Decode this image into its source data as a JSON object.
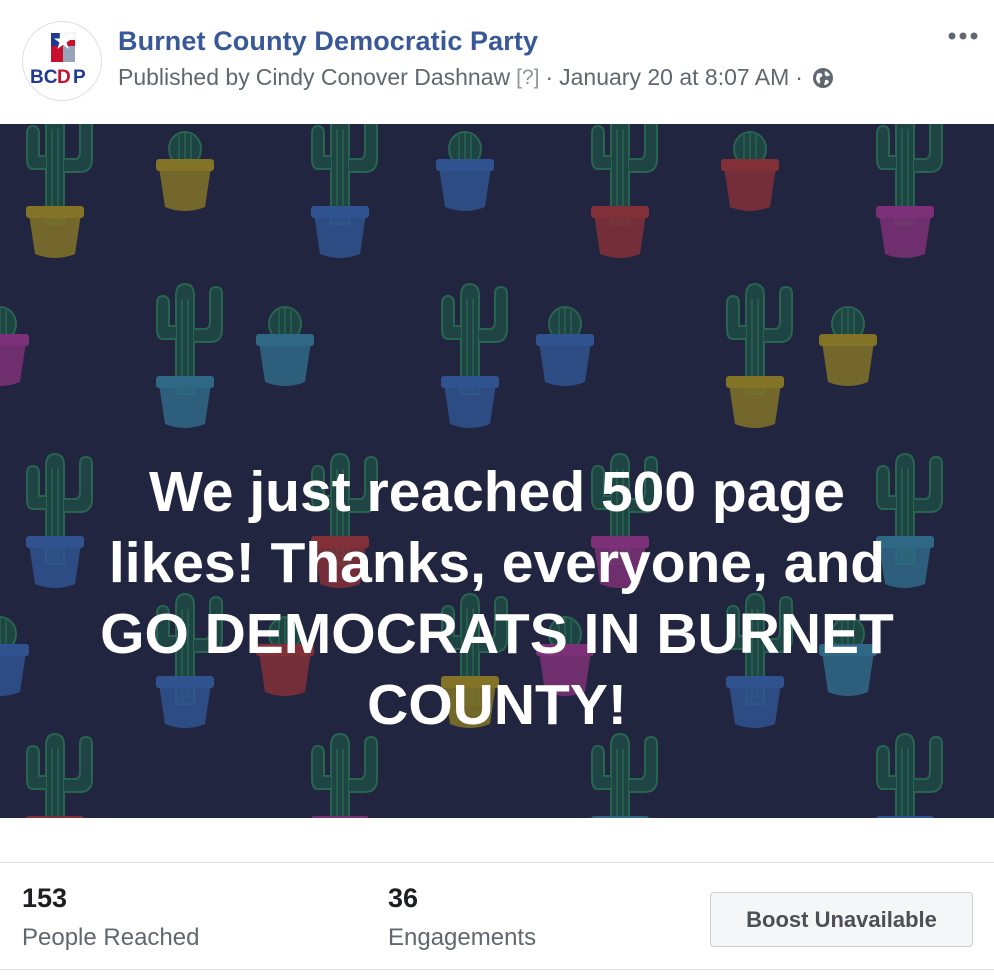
{
  "post": {
    "page_name": "Burnet County Democratic Party",
    "avatar_text": "BCDP",
    "published_prefix": "Published by",
    "author": "Cindy Conover Dashnaw",
    "help_marker": "[?]",
    "separator": "·",
    "timestamp": "January 20 at 8:07 AM",
    "audience_icon": "globe-icon",
    "more_icon": "more-options-icon",
    "more_symbol": "•••"
  },
  "image": {
    "lines": [
      "We just reached 500 page",
      "likes! Thanks, everyone, and",
      "GO DEMOCRATS IN BURNET",
      "COUNTY!"
    ],
    "background_color": "#262844",
    "text_color": "#ffffff"
  },
  "insights": {
    "reached_value": "153",
    "reached_label": "People Reached",
    "engagements_value": "36",
    "engagements_label": "Engagements",
    "boost_label": "Boost Unavailable"
  },
  "colors": {
    "link": "#385898",
    "secondary_text": "#606770",
    "brand_red": "#c8102e",
    "brand_blue": "#1f3a93"
  }
}
